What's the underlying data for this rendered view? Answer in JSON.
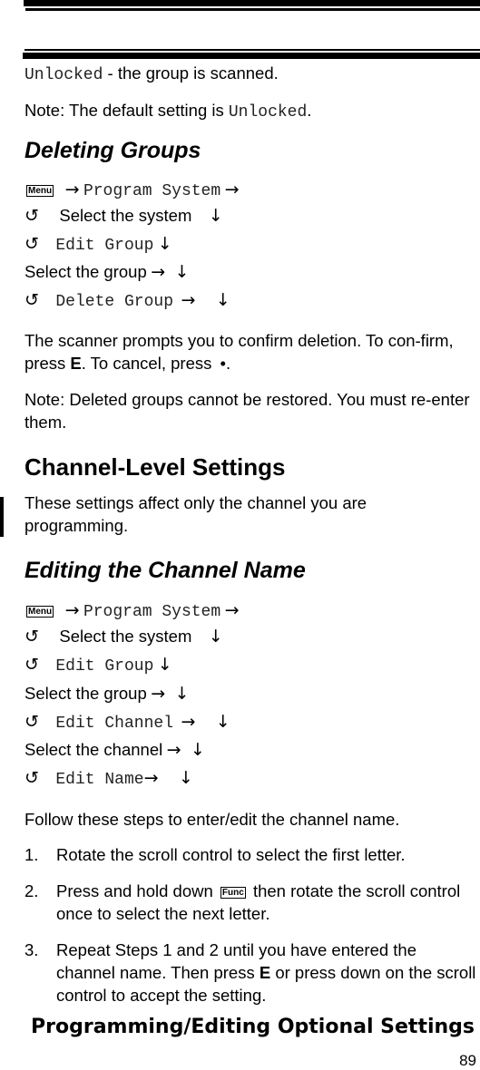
{
  "top_text": {
    "unlocked_code": "Unlocked",
    "unlocked_desc": " - the group is scanned.",
    "note_prefix": "Note: The default setting is ",
    "note_code": "Unlocked",
    "note_suffix": "."
  },
  "deleting_groups": {
    "heading": "Deleting Groups",
    "menu_key": "Menu",
    "steps": {
      "s1_code": "Program System",
      "s2_text": "Select the system",
      "s3_code": "Edit Group",
      "s4_text": "Select the group",
      "s5_code": "Delete Group"
    },
    "para1_a": "The scanner prompts you to confirm deletion. To con-firm, press ",
    "para1_key_e": "E",
    "para1_b": ". To cancel, press ",
    "para1_dot": "•",
    "para1_c": ".",
    "note": "Note: Deleted groups cannot be restored. You must re-enter them."
  },
  "channel_level": {
    "heading": "Channel-Level Settings",
    "para": "These settings affect only the channel you are programming."
  },
  "editing_name": {
    "heading": "Editing the Channel Name",
    "menu_key": "Menu",
    "steps": {
      "s1_code": "Program System",
      "s2_text": "Select the system",
      "s3_code": "Edit Group",
      "s4_text": "Select the group",
      "s5_code": "Edit Channel",
      "s6_text": "Select the channel",
      "s7_code": "Edit Name"
    },
    "intro": "Follow these steps to enter/edit the channel name.",
    "list": [
      {
        "num": "1.",
        "text": "Rotate the scroll control to select the first letter."
      },
      {
        "num": "2.",
        "text_a": "Press and hold down ",
        "key": "Func",
        "text_b": " then rotate the scroll control once to select the next letter."
      },
      {
        "num": "3.",
        "text_a": "Repeat Steps 1 and 2 until you have entered the channel name. Then press ",
        "key_e": "E",
        "text_b": " or press down on the scroll control to accept the setting."
      }
    ]
  },
  "glyphs": {
    "arrow_right": "→",
    "arrow_down": "↓",
    "rotate": "↺"
  },
  "footer": {
    "section_title": "Programming/Editing Optional Settings",
    "page_number": "89"
  }
}
